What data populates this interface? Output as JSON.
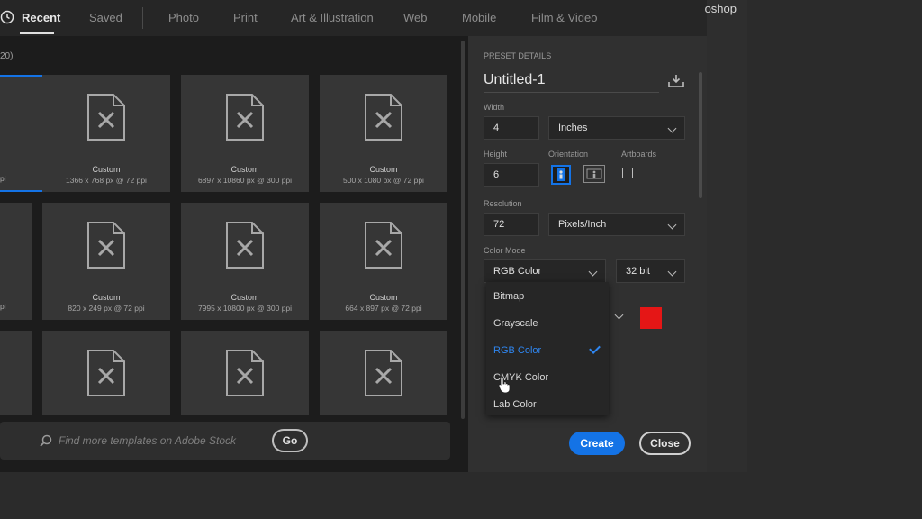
{
  "app_title": "oshop",
  "tabs": [
    {
      "label": "Recent",
      "active": true
    },
    {
      "label": "Saved"
    },
    {
      "label": "Photo"
    },
    {
      "label": "Print"
    },
    {
      "label": "Art & Illustration"
    },
    {
      "label": "Web"
    },
    {
      "label": "Mobile"
    },
    {
      "label": "Film & Video"
    }
  ],
  "templates": {
    "count_label": "20)",
    "partial_labels": [
      "pi",
      "pi"
    ],
    "cards": [
      {
        "name": "Custom",
        "size": "1366 x 768 px @ 72 ppi"
      },
      {
        "name": "Custom",
        "size": "6897 x 10860 px @ 300 ppi"
      },
      {
        "name": "Custom",
        "size": "500 x 1080 px @ 72 ppi"
      },
      {
        "name": "Custom",
        "size": "820 x 249 px @ 72 ppi"
      },
      {
        "name": "Custom",
        "size": "7995 x 10800 px @ 300 ppi"
      },
      {
        "name": "Custom",
        "size": "664 x 897 px @ 72 ppi"
      }
    ]
  },
  "search": {
    "placeholder": "Find more templates on Adobe Stock",
    "go_label": "Go",
    "icon": "search-icon"
  },
  "preset": {
    "section_label": "PRESET DETAILS",
    "title": "Untitled-1",
    "width_label": "Width",
    "width_value": "4",
    "width_unit": "Inches",
    "height_label": "Height",
    "height_value": "6",
    "orientation_label": "Orientation",
    "artboards_label": "Artboards",
    "resolution_label": "Resolution",
    "resolution_value": "72",
    "resolution_unit": "Pixels/Inch",
    "color_mode_label": "Color Mode",
    "color_mode_value": "RGB Color",
    "bit_depth": "32 bit",
    "background_color": "#e51616"
  },
  "color_mode_options": [
    {
      "label": "Bitmap"
    },
    {
      "label": "Grayscale"
    },
    {
      "label": "RGB Color",
      "selected": true
    },
    {
      "label": "CMYK Color"
    },
    {
      "label": "Lab Color"
    }
  ],
  "actions": {
    "create_label": "Create",
    "close_label": "Close"
  },
  "colors": {
    "accent": "#1473e6",
    "panel": "#303030",
    "background": "#1c1c1c"
  }
}
